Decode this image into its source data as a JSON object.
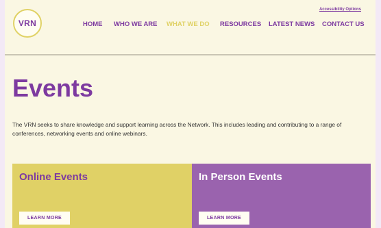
{
  "header": {
    "logo_text": "VRN",
    "accessibility_link": "Accessibility Options",
    "nav": [
      {
        "label": "HOME",
        "active": false
      },
      {
        "label": "WHO WE ARE",
        "active": false
      },
      {
        "label": "WHAT WE DO",
        "active": true
      },
      {
        "label": "RESOURCES",
        "active": false
      },
      {
        "label": "LATEST NEWS",
        "active": false
      },
      {
        "label": "CONTACT US",
        "active": false
      }
    ]
  },
  "main": {
    "title": "Events",
    "intro": "The VRN seeks to share knowledge and support learning across the Network. This includes leading and contributing to a range of conferences, networking events and online webinars.",
    "cards": [
      {
        "title": "Online Events",
        "button": "LEARN MORE"
      },
      {
        "title": "In Person Events",
        "button": "LEARN MORE"
      }
    ]
  },
  "colors": {
    "brand_purple": "#7d3aa0",
    "accent_yellow": "#e0d166",
    "card_purple": "#9a63ae",
    "page_background": "#faf7e3"
  }
}
